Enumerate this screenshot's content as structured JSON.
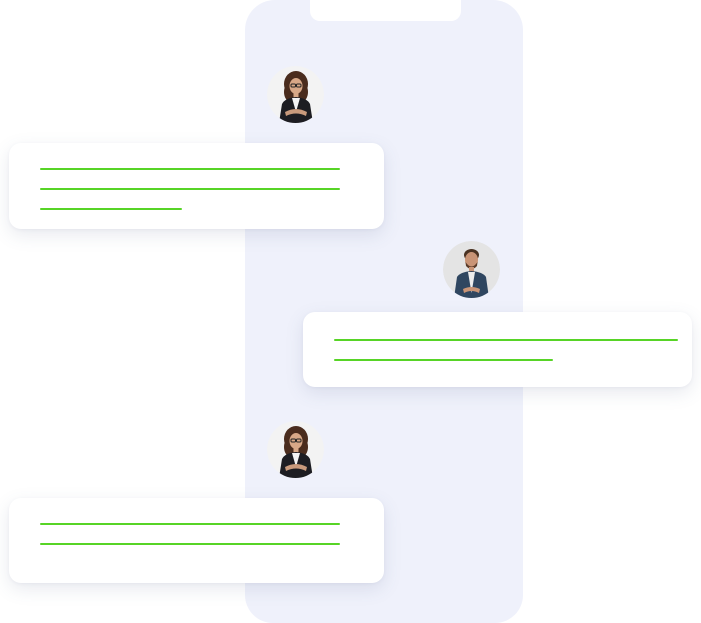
{
  "theme": {
    "line_color": "#57d426",
    "phone_color": "#eff1fb",
    "bubble_color": "#ffffff"
  },
  "messages": [
    {
      "sender": "woman-avatar",
      "side": "left",
      "line_count": 3
    },
    {
      "sender": "man-avatar",
      "side": "right",
      "line_count": 2
    },
    {
      "sender": "woman-avatar",
      "side": "left",
      "line_count": 2
    }
  ]
}
